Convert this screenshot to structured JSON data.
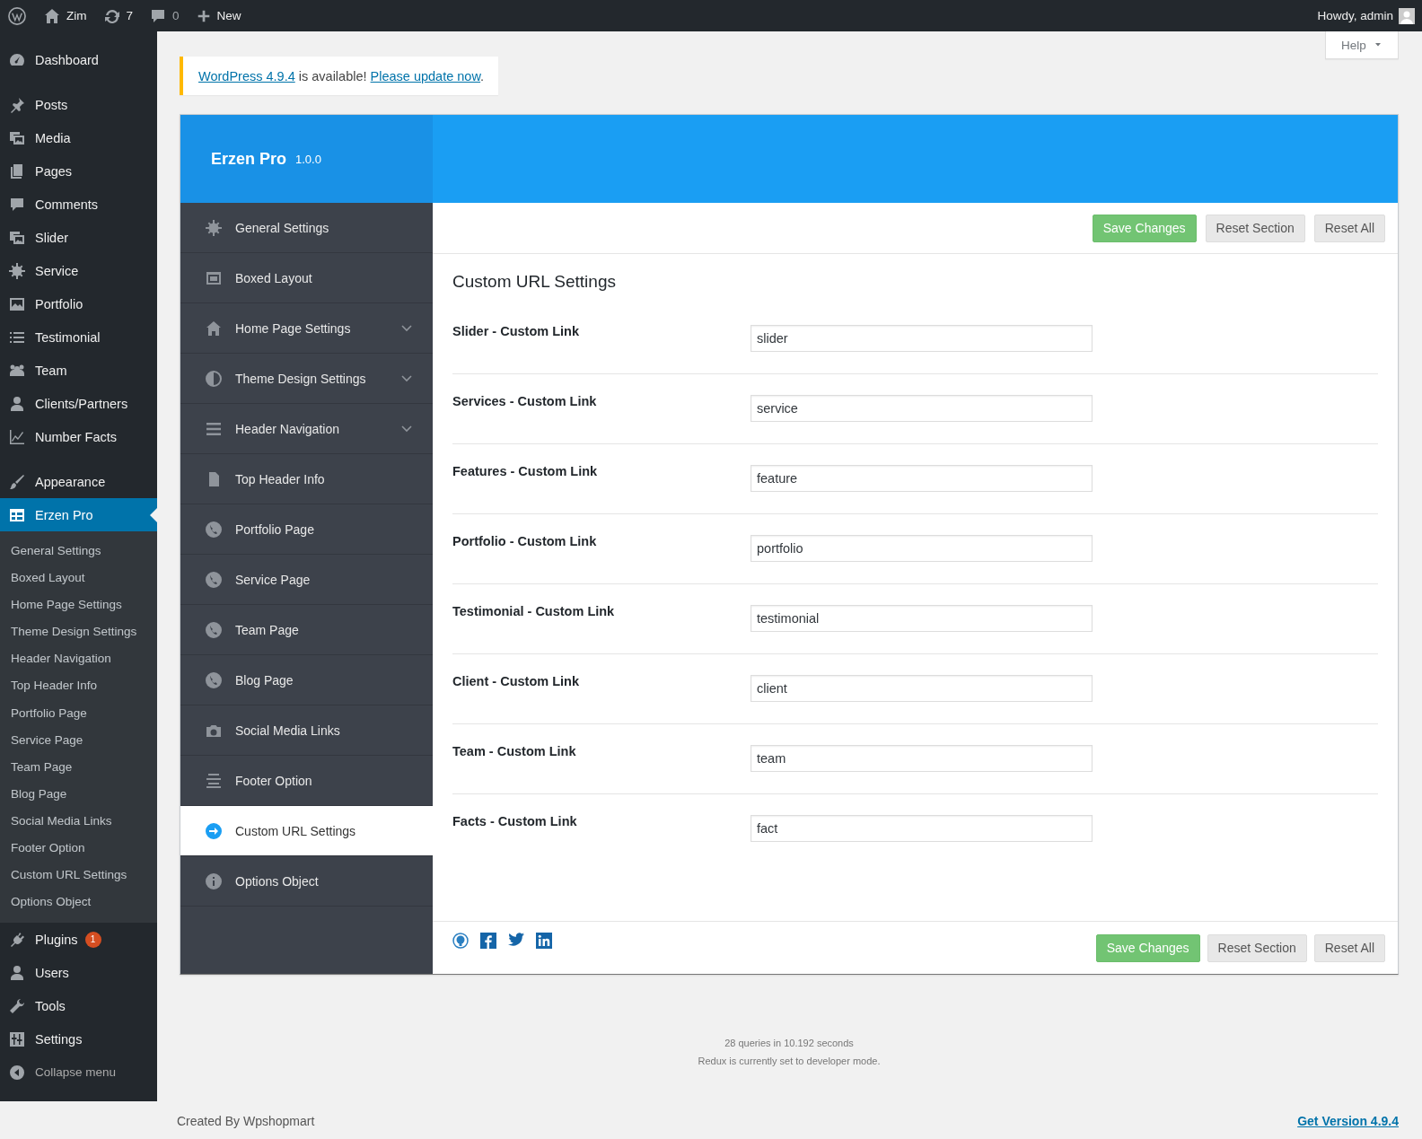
{
  "admin_bar": {
    "site_name": "Zim",
    "updates": "7",
    "comments": "0",
    "new_label": "New",
    "greeting": "Howdy, admin"
  },
  "sidebar": {
    "groups": [
      [
        {
          "label": "Dashboard",
          "selected": false
        }
      ],
      [
        {
          "label": "Posts",
          "selected": false
        },
        {
          "label": "Media",
          "selected": false
        },
        {
          "label": "Pages",
          "selected": false
        },
        {
          "label": "Comments",
          "selected": false
        },
        {
          "label": "Slider",
          "selected": false
        },
        {
          "label": "Service",
          "selected": false
        },
        {
          "label": "Portfolio",
          "selected": false
        },
        {
          "label": "Testimonial",
          "selected": false
        },
        {
          "label": "Team",
          "selected": false
        },
        {
          "label": "Clients/Partners",
          "selected": false
        },
        {
          "label": "Number Facts",
          "selected": false
        }
      ],
      [
        {
          "label": "Appearance",
          "selected": false
        },
        {
          "label": "Erzen Pro",
          "selected": true,
          "submenu": [
            "General Settings",
            "Boxed Layout",
            "Home Page Settings",
            "Theme Design Settings",
            "Header Navigation",
            "Top Header Info",
            "Portfolio Page",
            "Service Page",
            "Team Page",
            "Blog Page",
            "Social Media Links",
            "Footer Option",
            "Custom URL Settings",
            "Options Object"
          ]
        },
        {
          "label": "Plugins",
          "selected": false,
          "badge": "1"
        },
        {
          "label": "Users",
          "selected": false
        },
        {
          "label": "Tools",
          "selected": false
        },
        {
          "label": "Settings",
          "selected": false
        }
      ]
    ],
    "collapse_label": "Collapse menu"
  },
  "help_tab": {
    "label": "Help"
  },
  "notice": {
    "version_link": "WordPress 4.9.4",
    "message": "is available!",
    "update_link": "Please update now",
    "end": "."
  },
  "panel": {
    "title": "Erzen Pro",
    "version": "1.0.0",
    "nav": [
      {
        "label": "General Settings",
        "selected": false,
        "expandable": false
      },
      {
        "label": "Boxed Layout",
        "selected": false,
        "expandable": false
      },
      {
        "label": "Home Page Settings",
        "selected": false,
        "expandable": true
      },
      {
        "label": "Theme Design Settings",
        "selected": false,
        "expandable": true
      },
      {
        "label": "Header Navigation",
        "selected": false,
        "expandable": true
      },
      {
        "label": "Top Header Info",
        "selected": false,
        "expandable": false
      },
      {
        "label": "Portfolio Page",
        "selected": false,
        "expandable": false
      },
      {
        "label": "Service Page",
        "selected": false,
        "expandable": false
      },
      {
        "label": "Team Page",
        "selected": false,
        "expandable": false
      },
      {
        "label": "Blog Page",
        "selected": false,
        "expandable": false
      },
      {
        "label": "Social Media Links",
        "selected": false,
        "expandable": false
      },
      {
        "label": "Footer Option",
        "selected": false,
        "expandable": false
      },
      {
        "label": "Custom URL Settings",
        "selected": true,
        "expandable": false
      },
      {
        "label": "Options Object",
        "selected": false,
        "expandable": false
      }
    ],
    "top_buttons": [
      "Save Changes",
      "Reset Section",
      "Reset All"
    ],
    "section_title": "Custom URL Settings",
    "fields": [
      {
        "label": "Slider - Custom Link",
        "value": "slider"
      },
      {
        "label": "Services - Custom Link",
        "value": "service"
      },
      {
        "label": "Features - Custom Link",
        "value": "feature"
      },
      {
        "label": "Portfolio - Custom Link",
        "value": "portfolio"
      },
      {
        "label": "Testimonial - Custom Link",
        "value": "testimonial"
      },
      {
        "label": "Client - Custom Link",
        "value": "client"
      },
      {
        "label": "Team - Custom Link",
        "value": "team"
      },
      {
        "label": "Facts - Custom Link",
        "value": "fact"
      }
    ],
    "bottom_buttons": [
      "Save Changes",
      "Reset Section",
      "Reset All"
    ]
  },
  "footer": {
    "stats": "28 queries in 10.192 seconds",
    "mode_note": "Redux is currently set to developer mode.",
    "credit": "Created By Wpshopmart",
    "version_link": "Get Version 4.9.4"
  }
}
